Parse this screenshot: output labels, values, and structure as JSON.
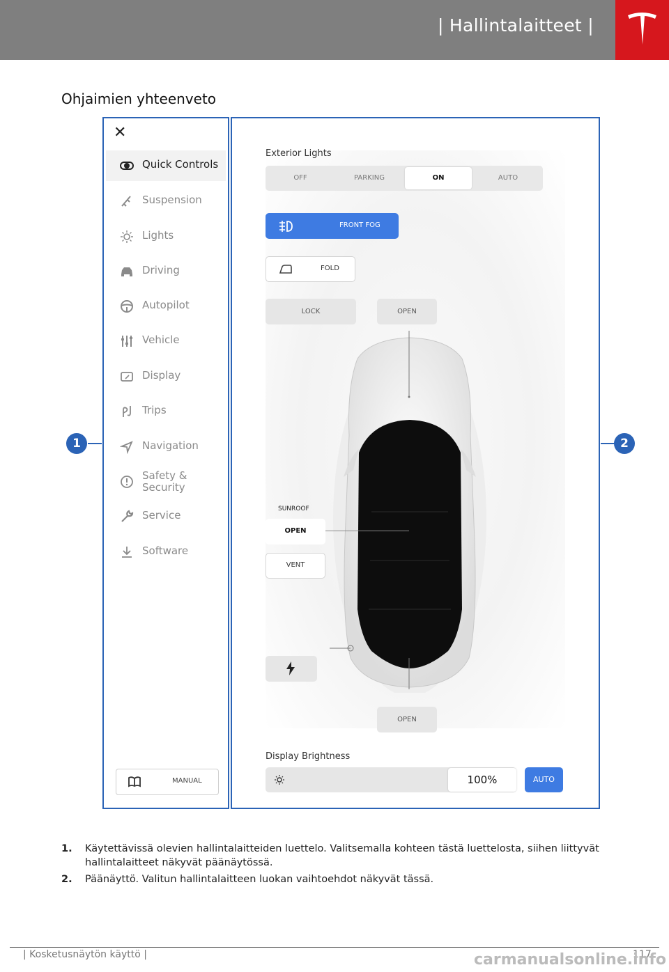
{
  "header": {
    "title": "| Hallintalaitteet |",
    "logo_icon": "tesla-logo-icon",
    "bar_color": "#7f7f7f",
    "logo_bg": "#d6171d"
  },
  "section_title": "Ohjaimien yhteenveto",
  "sidebar": {
    "close_icon": "close-icon",
    "items": [
      {
        "label": "Quick Controls",
        "icon": "toggle-icon",
        "active": true
      },
      {
        "label": "Suspension",
        "icon": "suspension-icon"
      },
      {
        "label": "Lights",
        "icon": "sun-icon"
      },
      {
        "label": "Driving",
        "icon": "car-icon"
      },
      {
        "label": "Autopilot",
        "icon": "steering-wheel-icon"
      },
      {
        "label": "Vehicle",
        "icon": "sliders-icon"
      },
      {
        "label": "Display",
        "icon": "display-icon"
      },
      {
        "label": "Trips",
        "icon": "trips-icon"
      },
      {
        "label": "Navigation",
        "icon": "navigation-icon"
      },
      {
        "label": "Safety & Security",
        "label_line1": "Safety &",
        "label_line2": "Security",
        "icon": "alert-icon"
      },
      {
        "label": "Service",
        "icon": "wrench-icon"
      },
      {
        "label": "Software",
        "icon": "download-icon"
      }
    ],
    "manual_button": "MANUAL"
  },
  "main": {
    "exterior_lights_label": "Exterior Lights",
    "lights_options": [
      "OFF",
      "PARKING",
      "ON",
      "AUTO"
    ],
    "lights_selected": "ON",
    "front_fog": "FRONT FOG",
    "fold": "FOLD",
    "lock": "LOCK",
    "frunk_open": "OPEN",
    "sunroof_label": "SUNROOF",
    "sunroof_open": "OPEN",
    "sunroof_vent": "VENT",
    "charge_icon": "lightning-icon",
    "trunk_open": "OPEN",
    "display_brightness_label": "Display Brightness",
    "brightness_value": "100%",
    "brightness_auto": "AUTO",
    "accent_color": "#3e7be2"
  },
  "callouts": [
    "1",
    "2"
  ],
  "captions": [
    {
      "num": "1.",
      "text": "Käytettävissä olevien hallintalaitteiden luettelo. Valitsemalla kohteen tästä luettelosta, siihen liittyvät hallintalaitteet näkyvät päänäytössä."
    },
    {
      "num": "2.",
      "text": "Päänäyttö. Valitun hallintalaitteen luokan vaihtoehdot näkyvät tässä."
    }
  ],
  "footer": {
    "text": "| Kosketusnäytön käyttö |",
    "page": "117"
  },
  "watermark": "carmanualsonline.info"
}
